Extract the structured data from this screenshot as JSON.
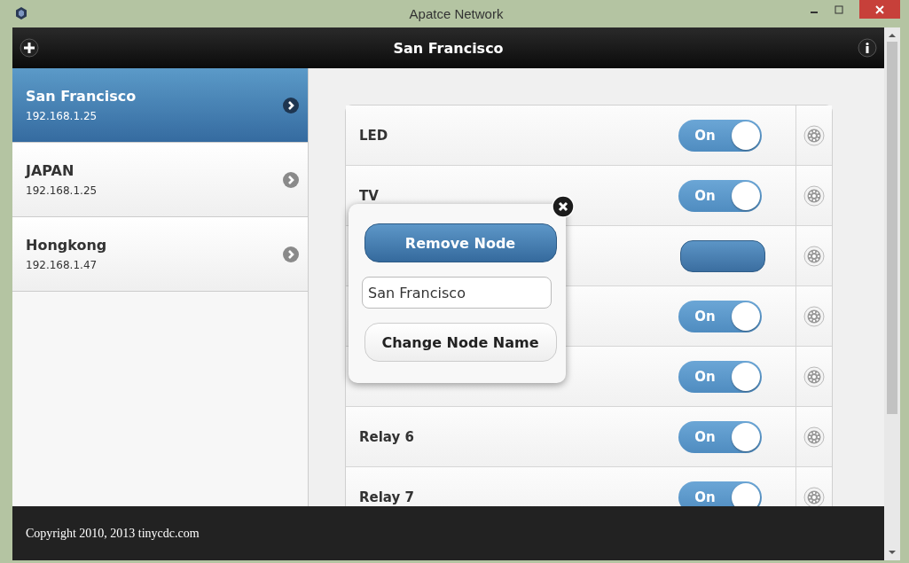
{
  "window": {
    "title": "Apatce Network"
  },
  "header": {
    "title": "San Francisco"
  },
  "nodes": [
    {
      "name": "San Francisco",
      "ip": "192.168.1.25",
      "selected": true
    },
    {
      "name": "JAPAN",
      "ip": "192.168.1.25",
      "selected": false
    },
    {
      "name": "Hongkong",
      "ip": "192.168.1.47",
      "selected": false
    }
  ],
  "devices": [
    {
      "kind": "toggle",
      "label": "LED",
      "on": true,
      "state_text": "On"
    },
    {
      "kind": "toggle",
      "label": "TV",
      "on": true,
      "state_text": "On"
    },
    {
      "kind": "button"
    },
    {
      "kind": "toggle",
      "on": true,
      "state_text": "On"
    },
    {
      "kind": "toggle",
      "on": true,
      "state_text": "On"
    },
    {
      "kind": "toggle",
      "label": "Relay 6",
      "on": true,
      "state_text": "On"
    },
    {
      "kind": "toggle",
      "label": "Relay 7",
      "on": true,
      "state_text": "On"
    }
  ],
  "popup": {
    "remove_button": "Remove Node",
    "name_field": "San Francisco",
    "rename_button": "Change Node Name"
  },
  "footer": "Copyright 2010, 2013 tinycdc.com"
}
